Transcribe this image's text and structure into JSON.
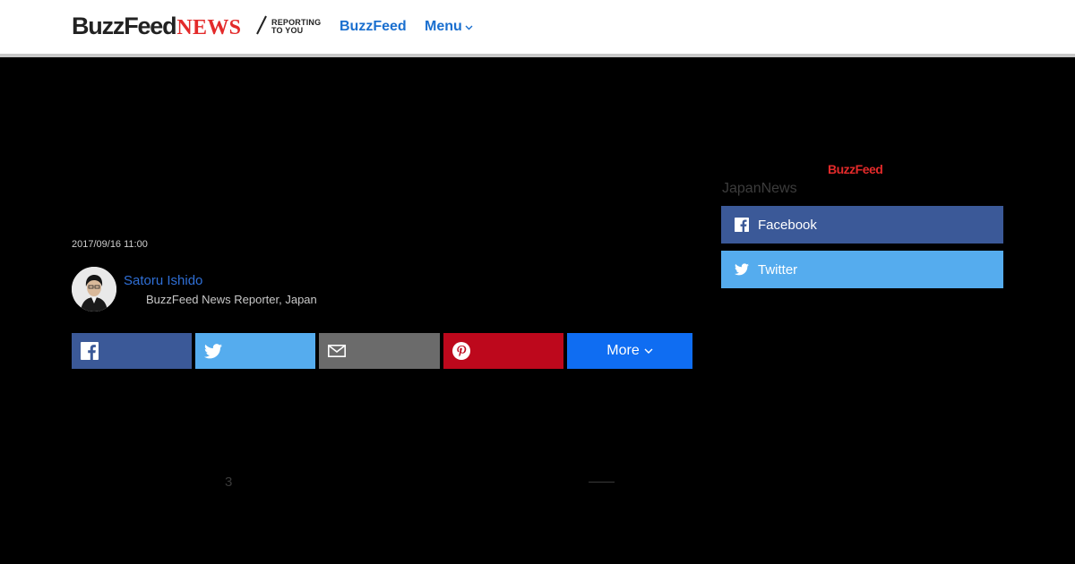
{
  "header": {
    "logo_main": "BuzzFeed",
    "logo_news": "NEWS",
    "tagline_line1": "REPORTING",
    "tagline_line2": "TO YOU",
    "nav_buzzfeed": "BuzzFeed",
    "nav_menu": "Menu"
  },
  "article": {
    "timestamp": "2017/09/16 11:00",
    "author_name": "Satoru Ishido",
    "author_title": "BuzzFeed News Reporter, Japan",
    "share_more_label": "More",
    "page_number": "3"
  },
  "sidebar": {
    "logo_text": "BuzzFeed",
    "heading": "JapanNews",
    "facebook_label": "Facebook",
    "twitter_label": "Twitter"
  },
  "colors": {
    "accent_blue": "#1a6fcf",
    "logo_red": "#e32a2a",
    "facebook": "#3b5998",
    "twitter": "#55acee",
    "email": "#6b6b6b",
    "pinterest": "#bd081c",
    "more": "#0f6df2"
  },
  "icons": [
    "facebook-icon",
    "twitter-icon",
    "email-icon",
    "pinterest-icon",
    "chevron-down-icon",
    "slash-icon"
  ]
}
